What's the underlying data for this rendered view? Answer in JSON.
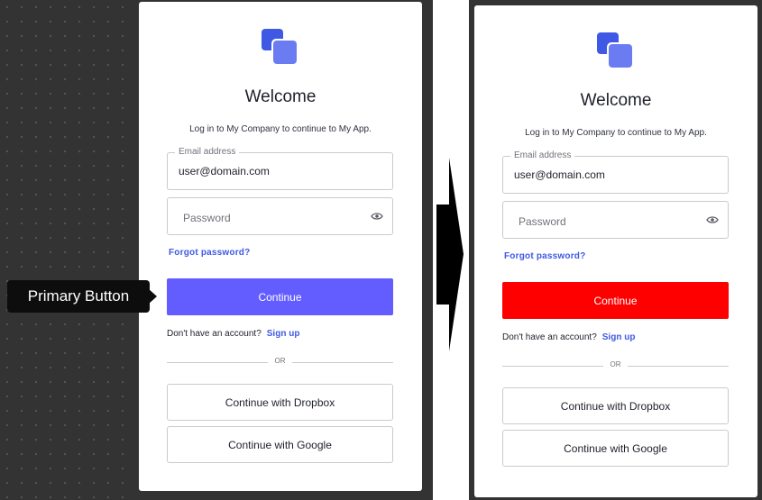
{
  "annotation": {
    "label": "Primary Button"
  },
  "before": {
    "title": "Welcome",
    "subtitle": "Log in to My Company to continue to My App.",
    "email": {
      "label": "Email address",
      "value": "user@domain.com"
    },
    "password": {
      "placeholder": "Password"
    },
    "forgot_link": "Forgot password?",
    "primary_button": "Continue",
    "primary_color": "#635dff",
    "signup_prompt": "Don't have an account?",
    "signup_link": "Sign up",
    "divider": "OR",
    "social": [
      "Continue with Dropbox",
      "Continue with Google"
    ]
  },
  "after": {
    "title": "Welcome",
    "subtitle": "Log in to My Company to continue to My App.",
    "email": {
      "label": "Email address",
      "value": "user@domain.com"
    },
    "password": {
      "placeholder": "Password"
    },
    "forgot_link": "Forgot password?",
    "primary_button": "Continue",
    "primary_color": "#ff0000",
    "signup_prompt": "Don't have an account?",
    "signup_link": "Sign up",
    "divider": "OR",
    "social": [
      "Continue with Dropbox",
      "Continue with Google"
    ]
  },
  "icons": {
    "logo": "brand-logo-icon",
    "eye": "eye-icon",
    "arrow": "right-arrow-icon"
  }
}
